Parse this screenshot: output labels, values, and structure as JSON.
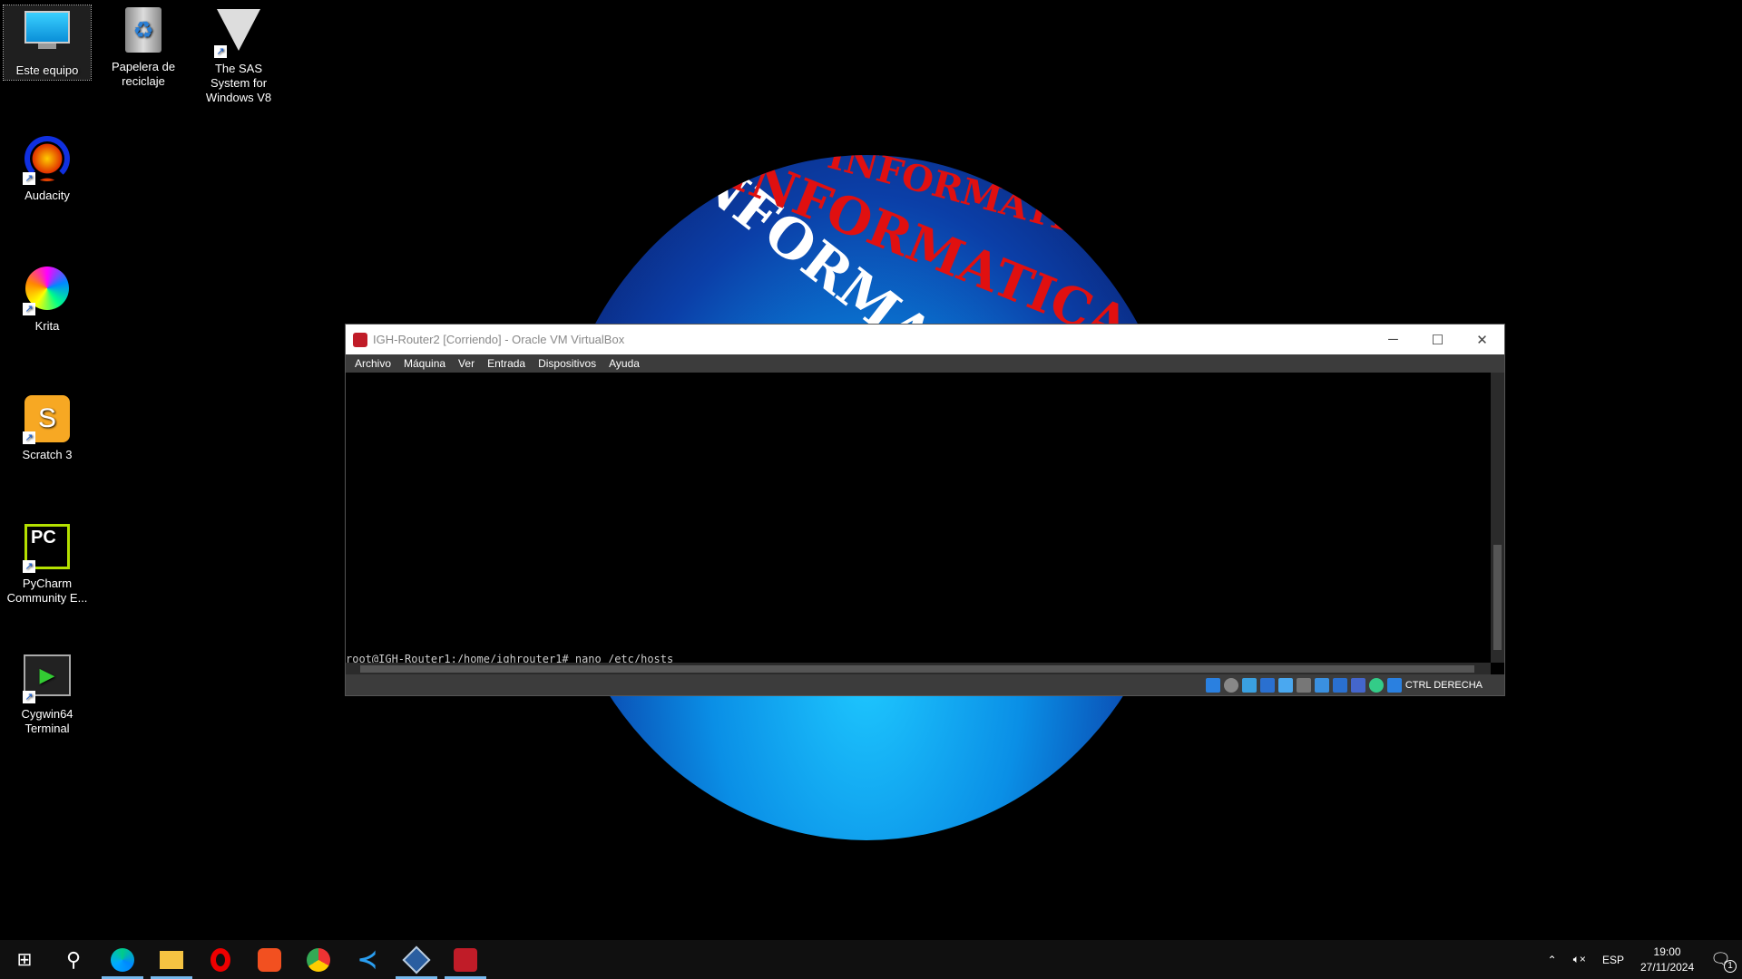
{
  "desktop": {
    "icons": [
      {
        "label": "Este equipo",
        "icon": "monitor-icon"
      },
      {
        "label": "Papelera de reciclaje",
        "icon": "recycle-bin-icon"
      },
      {
        "label": "The SAS System for Windows V8",
        "icon": "sas-icon"
      },
      {
        "label": "Audacity",
        "icon": "audacity-icon"
      },
      {
        "label": "Krita",
        "icon": "krita-icon"
      },
      {
        "label": "Scratch 3",
        "icon": "scratch-icon"
      },
      {
        "label": "PyCharm Community E...",
        "icon": "pycharm-icon"
      },
      {
        "label": "Cygwin64 Terminal",
        "icon": "cygwin-icon"
      }
    ],
    "wallpaper_text": "INFORMATICA"
  },
  "window": {
    "title": "IGH-Router2 [Corriendo] - Oracle VM VirtualBox",
    "menu": [
      "Archivo",
      "Máquina",
      "Ver",
      "Entrada",
      "Dispositivos",
      "Ayuda"
    ],
    "terminal_line": "root@IGH-Router1:/home/ighrouter1# nano /etc/hosts",
    "host_key": "CTRL DERECHA"
  },
  "taskbar": {
    "apps": [
      "start",
      "search",
      "edge",
      "file-explorer",
      "opera",
      "brave",
      "chrome",
      "vscode",
      "virtualbox",
      "vm-window"
    ],
    "tray": {
      "language": "ESP",
      "time": "19:00",
      "date": "27/11/2024",
      "notifications": "1"
    }
  }
}
